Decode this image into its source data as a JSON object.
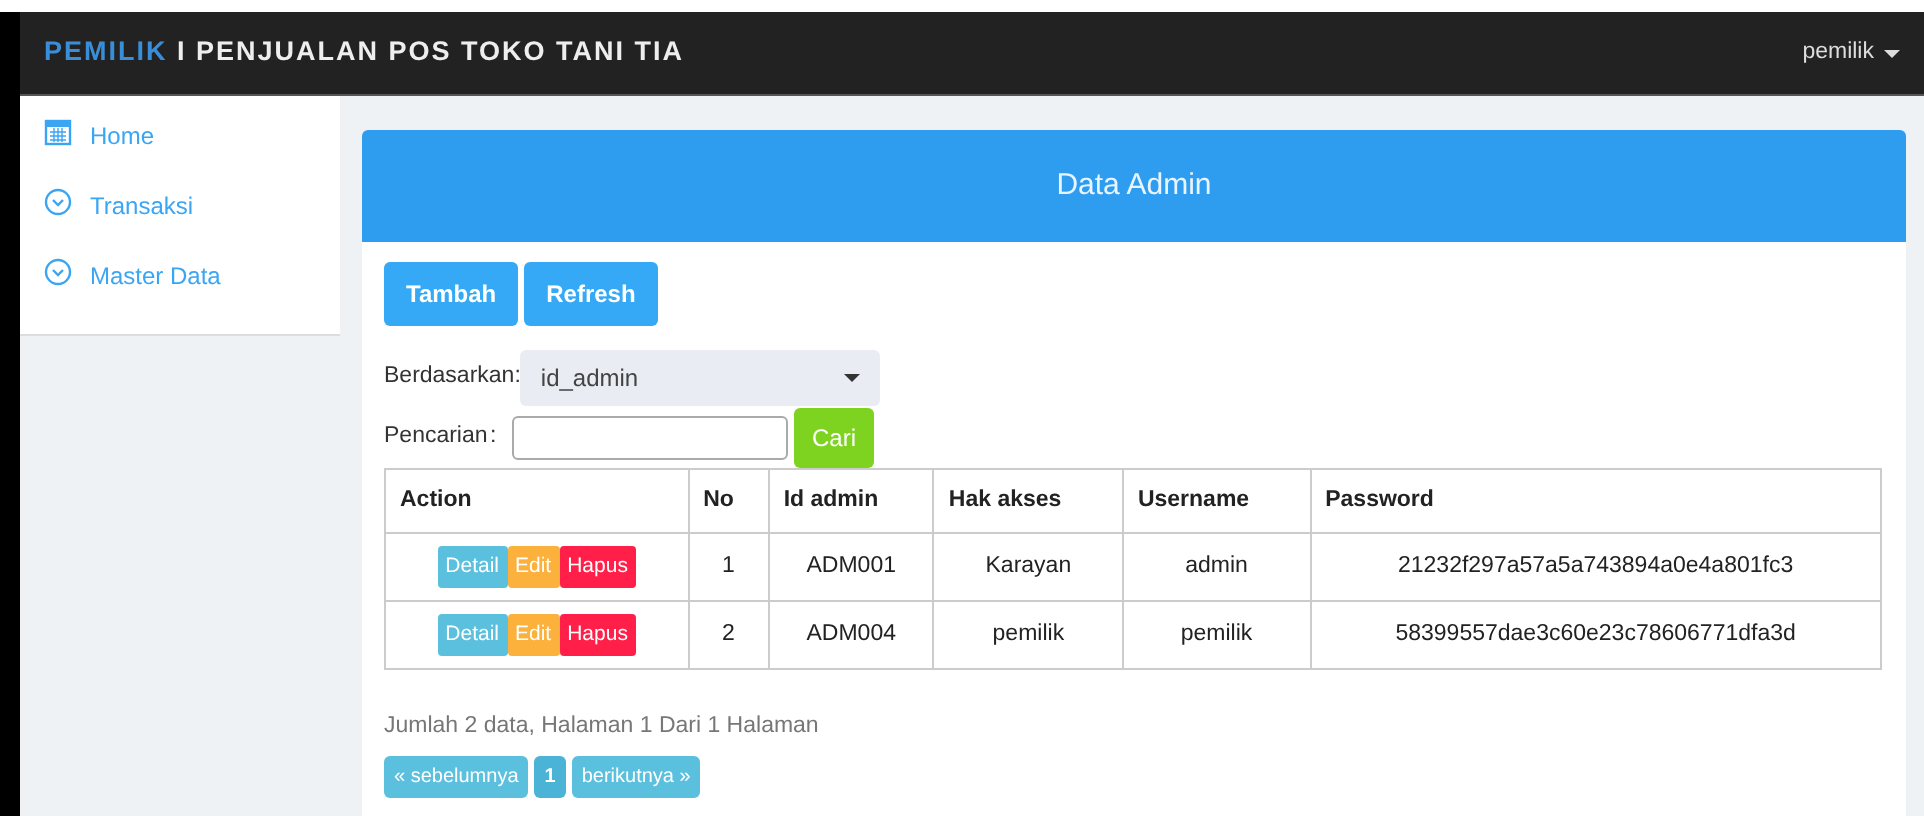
{
  "navbar": {
    "brand_role": "PEMILIK",
    "brand_separator": "I",
    "brand_title": "PENJUALAN POS TOKO TANI TIA",
    "user_menu": "pemilik"
  },
  "sidebar": {
    "items": [
      {
        "label": "Home",
        "kind": "calendar"
      },
      {
        "label": "Transaksi",
        "kind": "expand"
      },
      {
        "label": "Master Data",
        "kind": "expand"
      }
    ]
  },
  "panel": {
    "title": "Data Admin",
    "toolbar": [
      "Tambah",
      "Refresh"
    ],
    "filter": {
      "label": "Berdasarkan:",
      "value": "id_admin"
    },
    "search": {
      "label": "Pencarian",
      "separator": ":",
      "button": "Cari"
    },
    "table": {
      "columns": [
        "Action",
        "No",
        "Id admin",
        "Hak akses",
        "Username",
        "Password"
      ],
      "rows": [
        {
          "cells": [
            {
              "buttons": [
                {
                  "label": "Detail",
                  "kind": "info"
                },
                {
                  "label": "Edit",
                  "kind": "warning"
                },
                {
                  "label": "Hapus",
                  "kind": "danger"
                }
              ]
            },
            "1",
            "ADM001",
            "Karayan",
            "admin",
            "21232f297a57a5a743894a0e4a801fc3"
          ]
        },
        {
          "cells": [
            {
              "buttons": [
                {
                  "label": "Detail",
                  "kind": "info"
                },
                {
                  "label": "Edit",
                  "kind": "warning"
                },
                {
                  "label": "Hapus",
                  "kind": "danger"
                }
              ]
            },
            "2",
            "ADM004",
            "pemilik",
            "pemilik",
            "58399557dae3c60e23c78606771dfa3d"
          ]
        }
      ]
    },
    "summary": "Jumlah 2 data, Halaman 1 Dari 1 Halaman",
    "pagination": [
      {
        "label": "« sebelumnya",
        "selected": false
      },
      {
        "label": "1",
        "selected": true
      },
      {
        "label": "berikutnya »",
        "selected": false
      }
    ]
  }
}
